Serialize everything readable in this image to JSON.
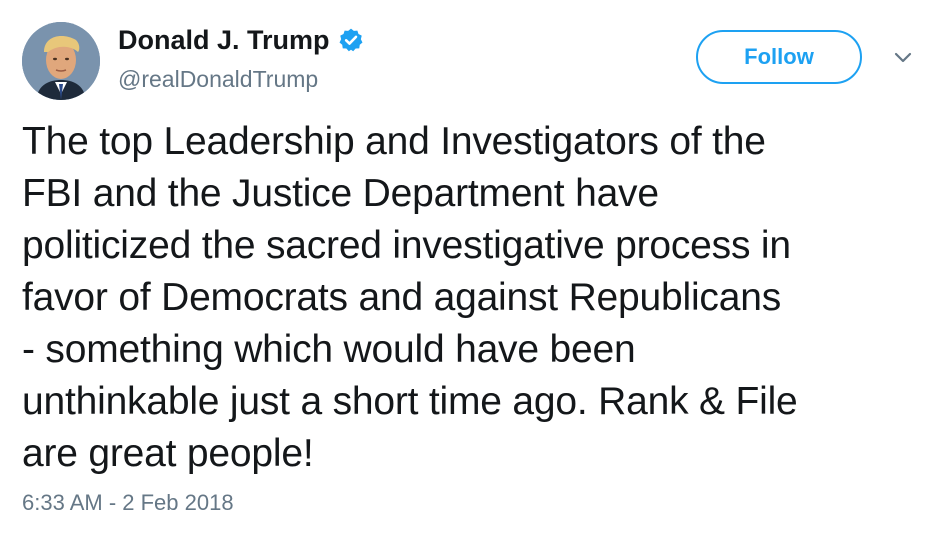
{
  "tweet": {
    "author": {
      "display_name": "Donald J. Trump",
      "handle": "@realDonaldTrump",
      "verified": true,
      "avatar_icon": "profile-photo"
    },
    "follow_label": "Follow",
    "menu_icon": "chevron-down-icon",
    "text": "The top Leadership and Investigators of the\nFBI and the Justice Department have\npoliticized the sacred investigative process in\nfavor of Democrats and against Republicans\n- something which would have been\nunthinkable just a short time ago. Rank & File\nare great people!",
    "timestamp": "6:33 AM - 2 Feb 2018"
  },
  "colors": {
    "accent": "#1da1f2",
    "text": "#14171a",
    "secondary_text": "#657786",
    "background": "#ffffff"
  }
}
